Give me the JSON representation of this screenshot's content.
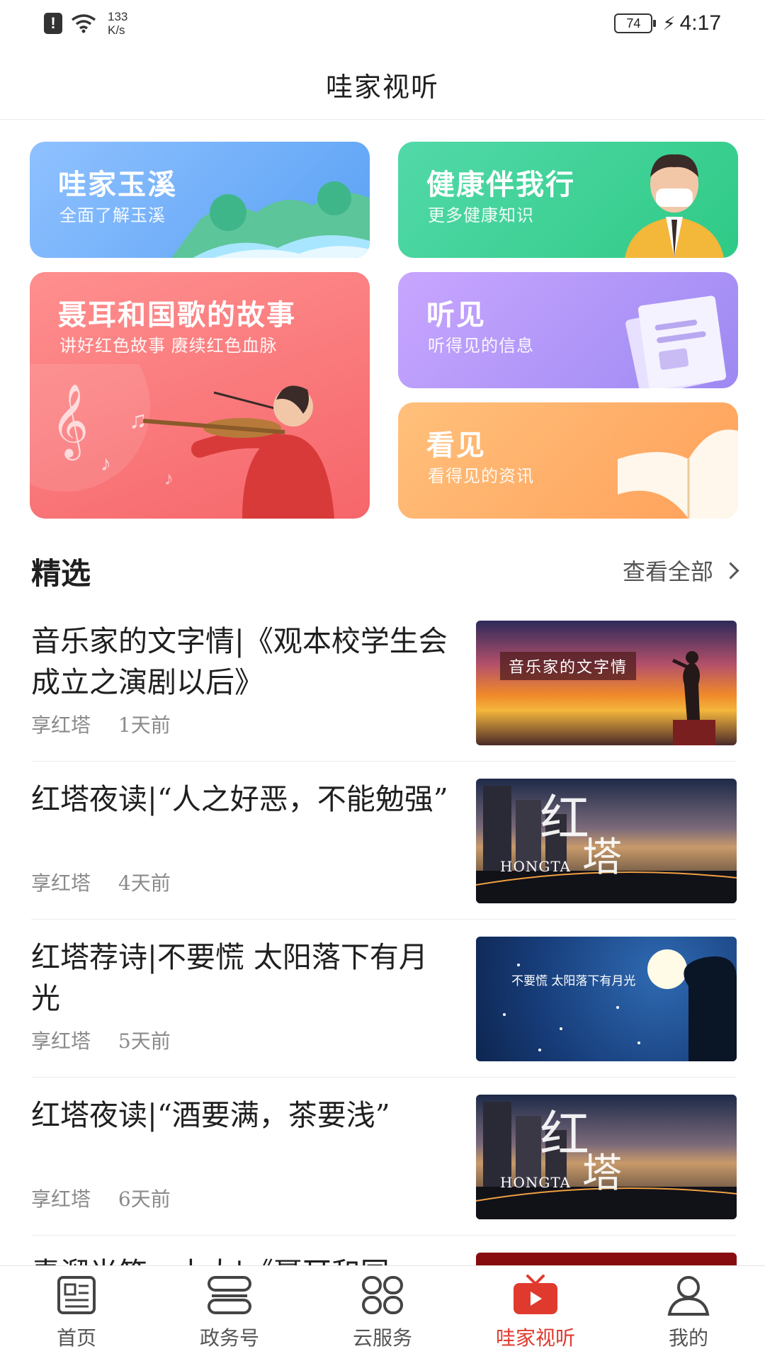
{
  "status_bar": {
    "net_speed_value": "133",
    "net_speed_unit": "K/s",
    "battery": "74",
    "time": "4:17"
  },
  "header": {
    "title": "哇家视听"
  },
  "cards": [
    {
      "title": "哇家玉溪",
      "subtitle": "全面了解玉溪"
    },
    {
      "title": "健康伴我行",
      "subtitle": "更多健康知识"
    },
    {
      "title": "聂耳和国歌的故事",
      "subtitle": "讲好红色故事   赓续红色血脉"
    },
    {
      "title": "听见",
      "subtitle": "听得见的信息"
    },
    {
      "title": "看见",
      "subtitle": "看得见的资讯"
    }
  ],
  "section": {
    "title": "精选",
    "view_all": "查看全部"
  },
  "articles": [
    {
      "title": "音乐家的文字情|《观本校学生会成立之演剧以后》",
      "source": "享红塔",
      "time": "1天前",
      "thumb_text": "音乐家的文字情"
    },
    {
      "title": "红塔夜读|“人之好恶，不能勉强”",
      "source": "享红塔",
      "time": "4天前",
      "thumb_text": "HONGTA"
    },
    {
      "title": "红塔荐诗|不要慌 太阳落下有月光",
      "source": "享红塔",
      "time": "5天前",
      "thumb_text": "不要慌 太阳落下有月光"
    },
    {
      "title": "红塔夜读|“酒要满，茶要浅”",
      "source": "享红塔",
      "time": "6天前",
      "thumb_text": "HONGTA"
    },
    {
      "title": "青溜光笑一土大|《聂耳和国",
      "source": "",
      "time": "",
      "thumb_text": ""
    }
  ],
  "tabbar": [
    {
      "label": "首页",
      "icon": "newspaper-icon"
    },
    {
      "label": "政务号",
      "icon": "government-icon"
    },
    {
      "label": "云服务",
      "icon": "grid-icon"
    },
    {
      "label": "哇家视听",
      "icon": "tv-play-icon",
      "active": true
    },
    {
      "label": "我的",
      "icon": "user-icon"
    }
  ],
  "colors": {
    "accent": "#e03a2f"
  }
}
